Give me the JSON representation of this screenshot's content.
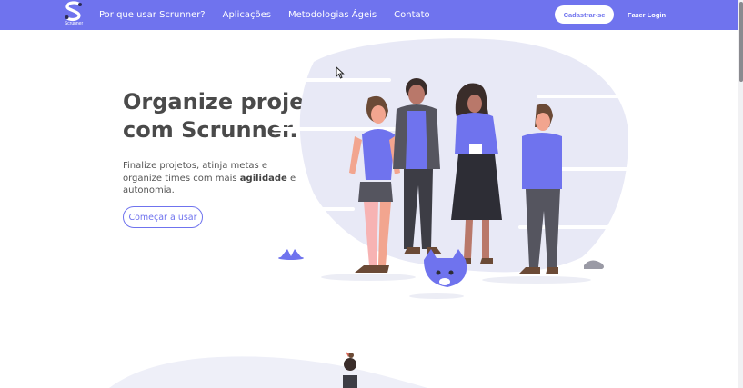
{
  "nav": {
    "logo_caption": "Scrunner",
    "links": [
      "Por que usar Scrunner?",
      "Aplicações",
      "Metodologias Ágeis",
      "Contato"
    ],
    "signup_label": "Cadastrar-se",
    "login_label": "Fazer Login"
  },
  "hero": {
    "title": "Organize projetos com Scrunner.",
    "desc_before": "Finalize projetos, atinja metas e organize times com mais ",
    "desc_bold": "agilidade",
    "desc_after": " e autonomia.",
    "cta_label": "Começar a usar"
  },
  "colors": {
    "accent": "#6f73ee",
    "illustration_blob": "#e8e9f6",
    "text": "#4a4a4a"
  }
}
